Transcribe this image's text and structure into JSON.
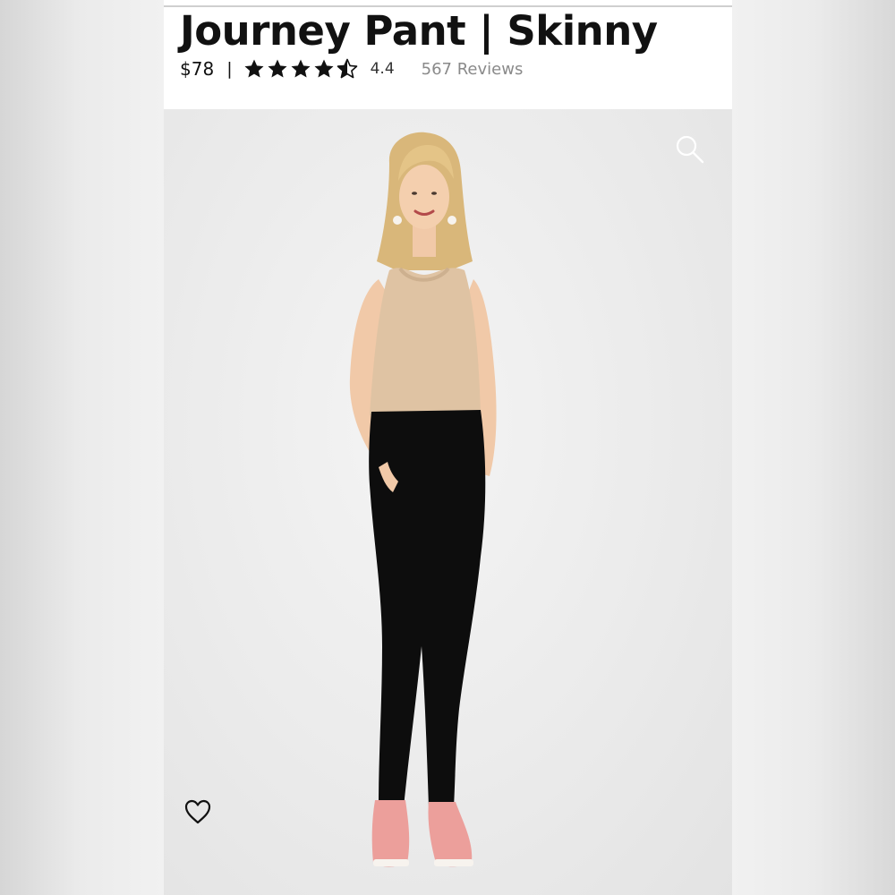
{
  "product": {
    "title": "Journey Pant | Skinny",
    "price": "$78",
    "separator": "|",
    "rating": {
      "value": "4.4",
      "max_stars": 5,
      "stars": [
        "full",
        "full",
        "full",
        "full",
        "half"
      ]
    },
    "reviews_label": "567 Reviews"
  },
  "photo": {
    "icons": {
      "zoom": "search-icon",
      "favorite": "heart-icon"
    }
  },
  "colors": {
    "text": "#111111",
    "muted": "#8a8a8a",
    "pants": "#0d0d0d",
    "top": "#dfc3a3",
    "shoes": "#ec9f9b"
  }
}
